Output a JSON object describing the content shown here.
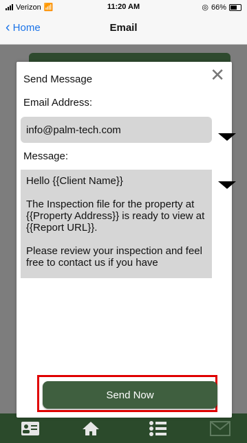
{
  "status_bar": {
    "carrier": "Verizon",
    "time": "11:20 AM",
    "battery_percent": "66%"
  },
  "nav": {
    "back_label": "Home",
    "title": "Email"
  },
  "modal": {
    "title": "Send Message",
    "email_label": "Email Address:",
    "email_value": "info@palm-tech.com",
    "message_label": "Message:",
    "message_paragraphs": [
      "Hello {{Client Name}}",
      "The Inspection file for the property at {{Property Address}} is ready to view at {{Report URL}}.",
      "Please review your inspection and feel free to contact us if you have"
    ],
    "send_label": "Send Now"
  },
  "tab_bar": {
    "icons": [
      "contact-card-icon",
      "home-icon",
      "list-icon",
      "mail-icon"
    ]
  },
  "colors": {
    "brand_green": "#2b4a2b",
    "button_green": "#3f5f3f",
    "highlight_red": "#e00000",
    "link_blue": "#1a73e8"
  }
}
